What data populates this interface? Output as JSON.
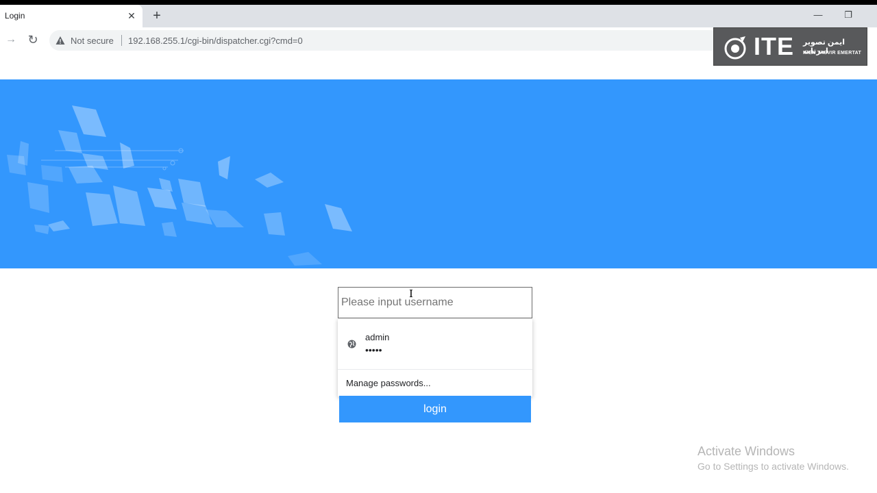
{
  "browser": {
    "tab_title": "Login",
    "tab_close": "✕",
    "new_tab": "+",
    "minimize": "—",
    "restore": "❐",
    "security_label": "Not secure",
    "url": "192.168.255.1/cgi-bin/dispatcher.cgi?cmd=0",
    "back_glyph": "→",
    "reload_glyph": "↻"
  },
  "watermark_logo": {
    "brand": "ITE",
    "persian_text": "ایمن تصویر امرتات",
    "english_text": "IMEN TASVIR EMERTAT"
  },
  "login_form": {
    "username_placeholder": "Please input username",
    "login_label": "login"
  },
  "autofill": {
    "saved_username": "admin",
    "saved_password_mask": "•••••",
    "manage_label": "Manage passwords..."
  },
  "os_watermark": {
    "title": "Activate Windows",
    "subtitle": "Go to Settings to activate Windows."
  },
  "colors": {
    "brand_blue": "#3397fd",
    "tabstrip": "#dee1e6",
    "omnibox": "#f1f3f4"
  }
}
